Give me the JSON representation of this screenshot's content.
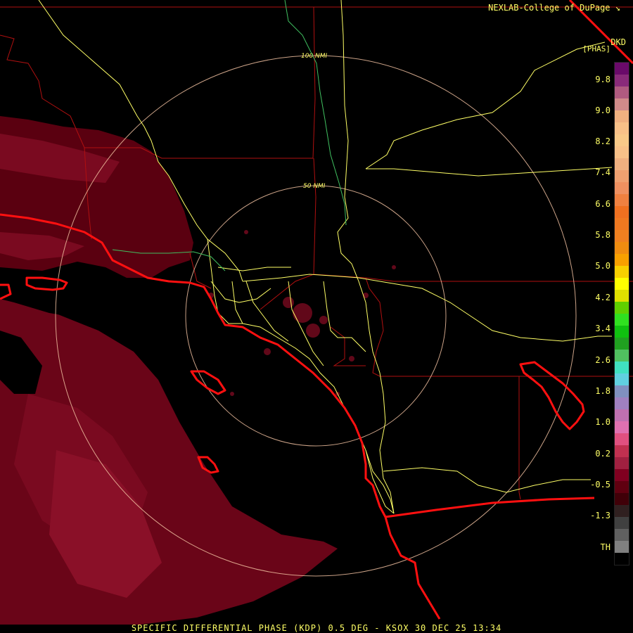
{
  "header": {
    "credit": "NEXLAB-College of DuPage",
    "credit_icon": "nexlab-arrow-icon",
    "product_code": "DKD",
    "unit": "[PHAS]"
  },
  "rings": [
    {
      "label": "100 NMI"
    },
    {
      "label": "50 NMI"
    }
  ],
  "colorbar": {
    "labels": [
      "9.8",
      "9.0",
      "8.2",
      "7.4",
      "6.6",
      "5.8",
      "5.0",
      "4.2",
      "3.4",
      "2.6",
      "1.8",
      "1.0",
      "0.2",
      "-0.5",
      "-1.3",
      "TH"
    ],
    "colors": [
      "#6a0a6a",
      "#8a2a7a",
      "#b05a80",
      "#d08a8a",
      "#f0b080",
      "#f8c088",
      "#f8c888",
      "#f8c088",
      "#f0b080",
      "#f0a070",
      "#f09060",
      "#f08040",
      "#f07020",
      "#f07820",
      "#f08020",
      "#f08c10",
      "#f8a000",
      "#f8d000",
      "#ffff00",
      "#e0e000",
      "#60d000",
      "#30e020",
      "#10c010",
      "#20a020",
      "#50c060",
      "#40e0c0",
      "#60d0e0",
      "#8090c0",
      "#a080c0",
      "#c070b0",
      "#e070b0",
      "#e05080",
      "#c03050",
      "#a02040",
      "#800020",
      "#600010",
      "#400008",
      "#302020",
      "#404040",
      "#606060",
      "#808080",
      "#000000"
    ]
  },
  "footer": {
    "product_line": "SPECIFIC DIFFERENTIAL PHASE (KDP) 0.5 DEG - KSOX 30 DEC 25 13:34"
  },
  "colors": {
    "background": "#000000",
    "county_lines": "#b01010",
    "highways": "#ffff66",
    "coastline": "#ff1010",
    "rings": "#f0c0a0",
    "echo_dark": "#5a0010",
    "echo_mid": "#7a0a20",
    "echo_light": "#9a1a35"
  }
}
